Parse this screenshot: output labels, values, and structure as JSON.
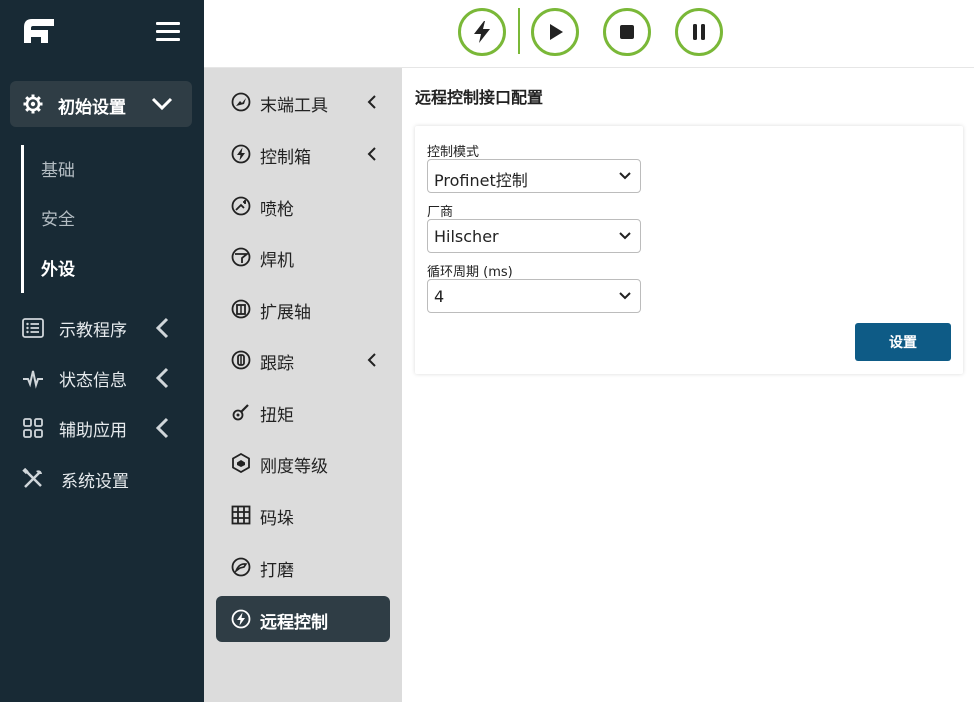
{
  "sidebar": {
    "menu_icon": "hamburger-icon",
    "logo_icon": "brand-logo",
    "active_section": {
      "label": "初始设置",
      "icon": "gear-icon"
    },
    "subitems": [
      {
        "label": "基础"
      },
      {
        "label": "安全"
      },
      {
        "label": "外设",
        "active": true
      }
    ],
    "items": [
      {
        "label": "示教程序",
        "icon": "list-icon"
      },
      {
        "label": "状态信息",
        "icon": "pulse-icon"
      },
      {
        "label": "辅助应用",
        "icon": "grid-icon"
      },
      {
        "label": "系统设置",
        "icon": "tools-icon"
      }
    ]
  },
  "toolbar": {
    "buttons": [
      {
        "icon": "power-bolt-icon"
      },
      {
        "icon": "play-icon"
      },
      {
        "icon": "stop-icon"
      },
      {
        "icon": "pause-icon"
      }
    ],
    "accent_color": "#7ab838"
  },
  "peripherals": {
    "items": [
      {
        "label": "末端工具",
        "icon": "tool-end-icon",
        "expandable": true
      },
      {
        "label": "控制箱",
        "icon": "bolt-circle-icon",
        "expandable": true
      },
      {
        "label": "喷枪",
        "icon": "spray-gun-icon"
      },
      {
        "label": "焊机",
        "icon": "welder-icon"
      },
      {
        "label": "扩展轴",
        "icon": "axis-icon"
      },
      {
        "label": "跟踪",
        "icon": "track-icon",
        "expandable": true
      },
      {
        "label": "扭矩",
        "icon": "torque-icon"
      },
      {
        "label": "刚度等级",
        "icon": "stiffness-icon"
      },
      {
        "label": "码垛",
        "icon": "pallet-grid-icon"
      },
      {
        "label": "打磨",
        "icon": "grind-icon"
      },
      {
        "label": "远程控制",
        "icon": "bolt-circle-icon",
        "active": true
      }
    ]
  },
  "content": {
    "title": "远程控制接口配置",
    "fields": [
      {
        "label": "控制模式",
        "value": "Profinet控制"
      },
      {
        "label": "厂商",
        "value": "Hilscher"
      },
      {
        "label": "循环周期 (ms)",
        "value": "4"
      }
    ],
    "submit_label": "设置",
    "submit_color": "#0e5b86"
  }
}
